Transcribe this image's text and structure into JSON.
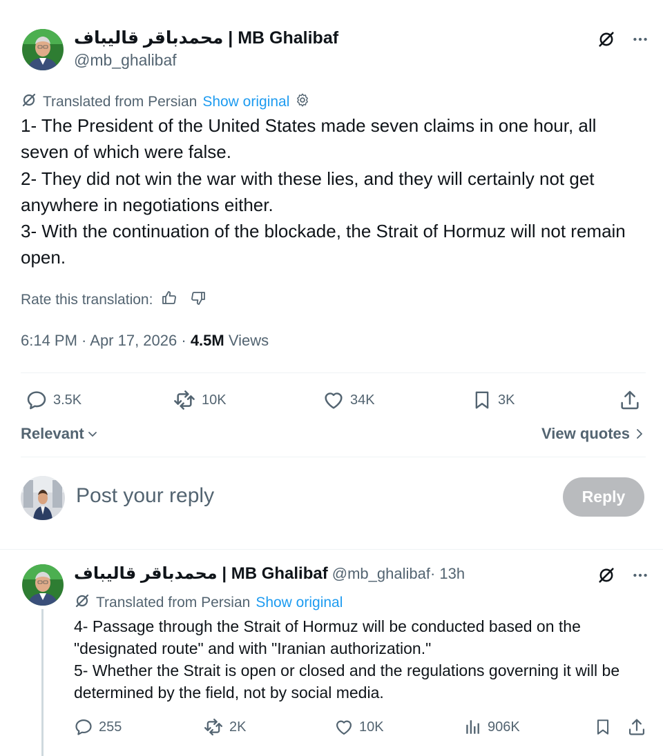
{
  "main_post": {
    "author_name": "محمدباقر قالیباف | MB Ghalibaf",
    "handle": "@mb_ghalibaf",
    "translation_note": "Translated from Persian",
    "show_original": "Show original",
    "paragraphs": [
      "1- The President of the United States made seven claims in one hour, all seven of which were false.",
      "2- They did not win the war with these lies, and they will certainly not get anywhere in negotiations either.",
      "3- With the continuation of the blockade, the Strait of Hormuz will not remain open."
    ],
    "rate_label": "Rate this translation:",
    "timestamp": "6:14 PM · Apr 17, 2026 · ",
    "views_count": "4.5M",
    "views_label": " Views",
    "stats": {
      "replies": "3.5K",
      "reposts": "10K",
      "likes": "34K",
      "bookmarks": "3K"
    },
    "sort_label": "Relevant",
    "view_quotes": "View quotes",
    "reply_placeholder": "Post your reply",
    "reply_button": "Reply"
  },
  "reply_post": {
    "author_name": "محمدباقر قالیباف | MB Ghalibaf",
    "handle": "@mb_ghalibaf",
    "time": " · 13h",
    "translation_note": "Translated from Persian",
    "show_original": "Show original",
    "paragraphs": [
      "4- Passage through the Strait of Hormuz will be conducted based on the \"designated route\" and with \"Iranian authorization.\"",
      "5- Whether the Strait is open or closed and the regulations governing it will be determined by the field, not by social media."
    ],
    "stats": {
      "replies": "255",
      "reposts": "2K",
      "likes": "10K",
      "views": "906K"
    }
  },
  "icons": {
    "grok": "grok-icon",
    "more": "more-dots-icon",
    "reply": "speech-bubble-icon",
    "repost": "repost-arrows-icon",
    "like": "heart-icon",
    "bookmark": "bookmark-icon",
    "share": "share-upload-icon",
    "views": "bar-chart-icon",
    "thumbs_up": "thumbs-up-icon",
    "thumbs_down": "thumbs-down-icon",
    "settings": "gear-icon"
  },
  "colors": {
    "link": "#1d9bf0",
    "secondary_text": "#536471",
    "primary_text": "#0f1419",
    "reply_button_disabled": "#b9bbbe"
  }
}
